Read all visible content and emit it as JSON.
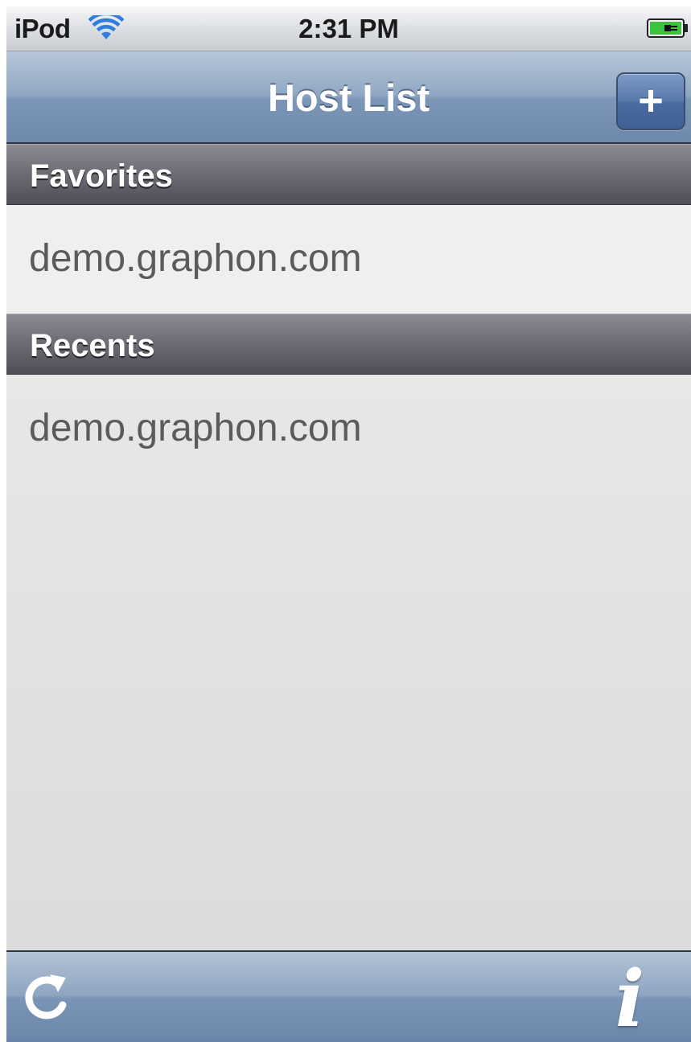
{
  "status_bar": {
    "carrier": "iPod",
    "time": "2:31 PM",
    "wifi_icon": "wifi-icon",
    "battery_icon": "battery-charging-icon"
  },
  "nav_bar": {
    "title": "Host List",
    "add_button_label": "+"
  },
  "sections": {
    "favorites": {
      "label": "Favorites",
      "items": [
        "demo.graphon.com"
      ]
    },
    "recents": {
      "label": "Recents",
      "items": [
        "demo.graphon.com"
      ]
    }
  },
  "toolbar": {
    "refresh_icon": "refresh-icon",
    "info_icon": "info-icon",
    "info_glyph": "i"
  },
  "colors": {
    "nav_bar": "#7d97b8",
    "section_header": "#6f6d76",
    "row_text": "#5b5b5b",
    "background": "#e6e6e6"
  }
}
